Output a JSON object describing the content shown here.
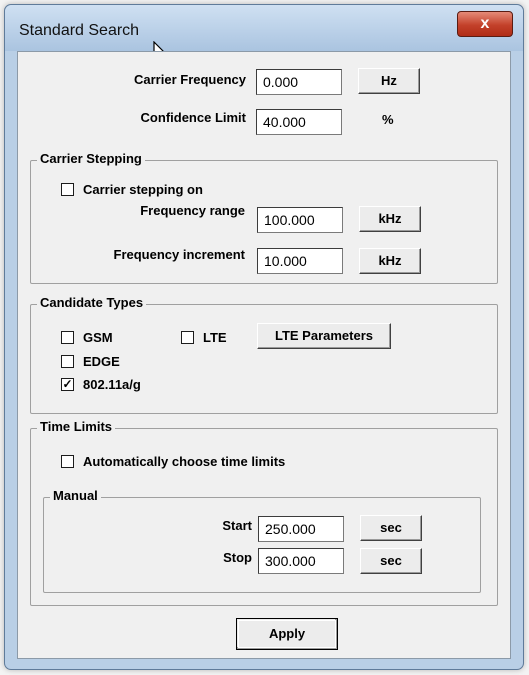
{
  "window": {
    "title": "Standard Search",
    "close_glyph": "x"
  },
  "carrier_frequency": {
    "label": "Carrier Frequency",
    "value": "0.000",
    "unit_button": "Hz"
  },
  "confidence_limit": {
    "label": "Confidence Limit",
    "value": "40.000",
    "unit": "%"
  },
  "carrier_stepping": {
    "group_title": "Carrier Stepping",
    "checkbox_label": "Carrier stepping on",
    "checked": false,
    "frequency_range": {
      "label": "Frequency range",
      "value": "100.000",
      "unit_button": "kHz"
    },
    "frequency_increment": {
      "label": "Frequency increment",
      "value": "10.000",
      "unit_button": "kHz"
    }
  },
  "candidate_types": {
    "group_title": "Candidate Types",
    "gsm": {
      "label": "GSM",
      "checked": false
    },
    "lte": {
      "label": "LTE",
      "checked": false
    },
    "edge": {
      "label": "EDGE",
      "checked": false
    },
    "wifi": {
      "label": "802.11a/g",
      "checked": true,
      "check_glyph": "✓"
    },
    "lte_parameters_button": "LTE Parameters"
  },
  "time_limits": {
    "group_title": "Time Limits",
    "auto_checkbox_label": "Automatically choose time limits",
    "auto_checked": false,
    "manual": {
      "group_title": "Manual",
      "start": {
        "label": "Start",
        "value": "250.000",
        "unit_button": "sec"
      },
      "stop": {
        "label": "Stop",
        "value": "300.000",
        "unit_button": "sec"
      }
    }
  },
  "apply_button": "Apply"
}
